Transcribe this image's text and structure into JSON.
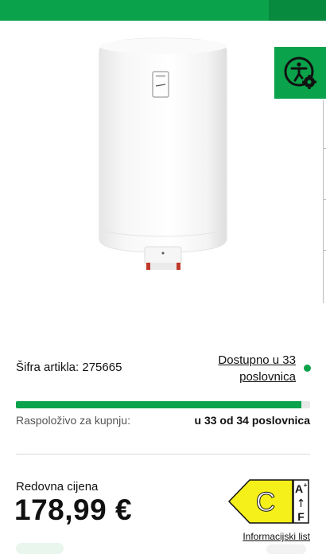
{
  "colors": {
    "brand_green": "#0aa24a",
    "energy_yellow": "#f5ef1a"
  },
  "product": {
    "sku_label": "Šifra artikla: 275665",
    "availability_link_line1": "Dostupno u 33",
    "availability_link_line2": "poslovnica",
    "stock_label": "Raspoloživo za kupnju:",
    "stock_value": "u 33 od 34 poslovnica",
    "stock_fraction": 0.97
  },
  "pricing": {
    "label": "Redovna cijena",
    "price": "178,99 €"
  },
  "energy_label": {
    "class": "C",
    "scale_top": "A",
    "scale_top_sup": "+",
    "scale_arrow": "↑",
    "scale_bottom": "F",
    "info_link": "Informacijski list"
  },
  "icons": {
    "accessibility": "accessibility-settings-icon"
  }
}
